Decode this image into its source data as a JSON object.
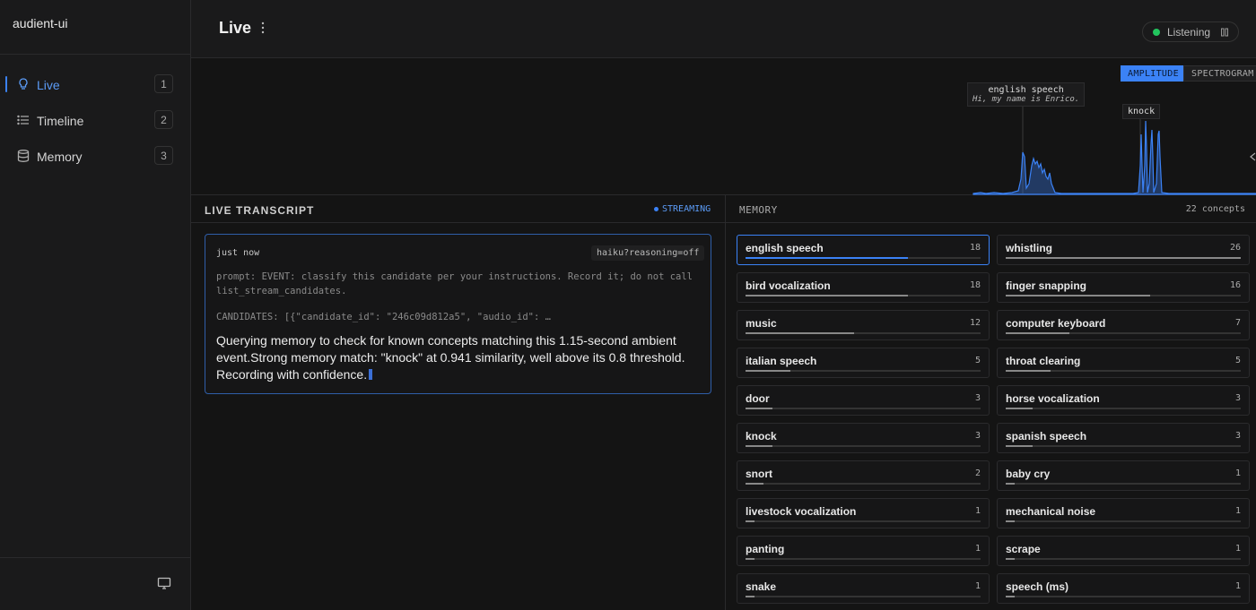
{
  "app": {
    "title": "audient-ui"
  },
  "sidebar": {
    "items": [
      {
        "label": "Live",
        "badge": "1",
        "icon": "lightbulb-icon",
        "active": true
      },
      {
        "label": "Timeline",
        "badge": "2",
        "icon": "list-icon",
        "active": false
      },
      {
        "label": "Memory",
        "badge": "3",
        "icon": "database-icon",
        "active": false
      }
    ],
    "bottom_icon": "monitor-icon"
  },
  "header": {
    "title": "Live",
    "status": "Listening",
    "status_color": "#22c55e"
  },
  "waveform": {
    "mode_amplitude": "AMPLITUDE",
    "mode_spectrogram": "SPECTROGRAM",
    "active_mode": "AMPLITUDE",
    "annotations": [
      {
        "label": "english speech",
        "sub": "Hi, my name is Enrico."
      },
      {
        "label": "knock",
        "sub": ""
      }
    ],
    "accent": "#3b82f6"
  },
  "transcript": {
    "title": "LIVE TRANSCRIPT",
    "status": "STREAMING",
    "entry": {
      "time": "just now",
      "model": "haiku?reasoning=off",
      "prompt": "prompt: EVENT: classify this candidate per your instructions. Record it; do not call list_stream_candidates.",
      "candidates": "CANDIDATES: [{\"candidate_id\": \"246c09d812a5\", \"audio_id\": …",
      "response": "Querying memory to check for known concepts matching this 1.15-second ambient event.Strong memory match: \"knock\" at 0.941 similarity, well above its 0.8 threshold. Recording with confidence."
    }
  },
  "memory": {
    "title": "MEMORY",
    "count_label": "22 concepts",
    "max": 26,
    "items": [
      {
        "name": "english speech",
        "count": 18,
        "selected": true
      },
      {
        "name": "whistling",
        "count": 26
      },
      {
        "name": "bird vocalization",
        "count": 18
      },
      {
        "name": "finger snapping",
        "count": 16
      },
      {
        "name": "music",
        "count": 12
      },
      {
        "name": "computer keyboard",
        "count": 7
      },
      {
        "name": "italian speech",
        "count": 5
      },
      {
        "name": "throat clearing",
        "count": 5
      },
      {
        "name": "door",
        "count": 3
      },
      {
        "name": "horse vocalization",
        "count": 3
      },
      {
        "name": "knock",
        "count": 3
      },
      {
        "name": "spanish speech",
        "count": 3
      },
      {
        "name": "snort",
        "count": 2
      },
      {
        "name": "baby cry",
        "count": 1
      },
      {
        "name": "livestock vocalization",
        "count": 1
      },
      {
        "name": "mechanical noise",
        "count": 1
      },
      {
        "name": "panting",
        "count": 1
      },
      {
        "name": "scrape",
        "count": 1
      },
      {
        "name": "snake",
        "count": 1
      },
      {
        "name": "speech (ms)",
        "count": 1
      }
    ]
  }
}
